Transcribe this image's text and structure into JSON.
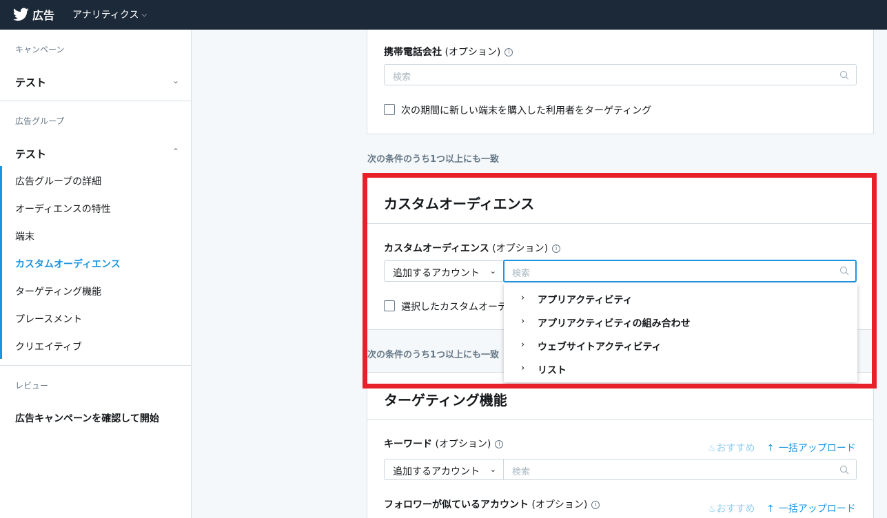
{
  "header": {
    "brand": "広告",
    "nav_label": "アナリティクス",
    "nav_chevron": "⌵"
  },
  "sidebar": {
    "campaign_caption": "キャンペーン",
    "campaign_name": "テスト",
    "adgroup_caption": "広告グループ",
    "adgroup_name": "テスト",
    "items": [
      {
        "label": "広告グループの詳細"
      },
      {
        "label": "オーディエンスの特性"
      },
      {
        "label": "端末"
      },
      {
        "label": "カスタムオーディエンス"
      },
      {
        "label": "ターゲティング機能"
      },
      {
        "label": "プレースメント"
      },
      {
        "label": "クリエイティブ"
      }
    ],
    "review_caption": "レビュー",
    "review_action": "広告キャンペーンを確認して開始"
  },
  "carrier_card": {
    "label_bold": "携帯電話会社",
    "label_optional": " (オプション)",
    "search_placeholder": "検索",
    "checkbox_label": "次の期間に新しい端末を購入した利用者をターゲティング"
  },
  "match_any_1": "次の条件のうち1つ以上にも一致",
  "custom_audience_card": {
    "title": "カスタムオーディエンス",
    "label_bold": "カスタムオーディエンス",
    "label_optional": " (オプション)",
    "dropdown_label": "追加するアカウント",
    "search_placeholder": "検索",
    "checkbox_label": "選択したカスタムオーデ"
  },
  "menu": {
    "items": [
      {
        "label": "アプリアクティビティ"
      },
      {
        "label": "アプリアクティビティの組み合わせ"
      },
      {
        "label": "ウェブサイトアクティビティ"
      },
      {
        "label": "リスト"
      }
    ]
  },
  "match_any_2": "次の条件のうち1つ以上にも一致",
  "targeting_card": {
    "title": "ターゲティング機能",
    "keyword_label_bold": "キーワード",
    "keyword_label_optional": " (オプション)",
    "recommend": "おすすめ",
    "bulk_upload": "一括アップロード",
    "dropdown_label": "追加するアカウント",
    "search_placeholder": "検索",
    "follower_label_bold": "フォロワーが似ているアカウント",
    "follower_label_optional": " (オプション)"
  },
  "colors": {
    "topbar": "#1c2938",
    "accent": "#1b95e0",
    "highlight": "#e8202a"
  }
}
